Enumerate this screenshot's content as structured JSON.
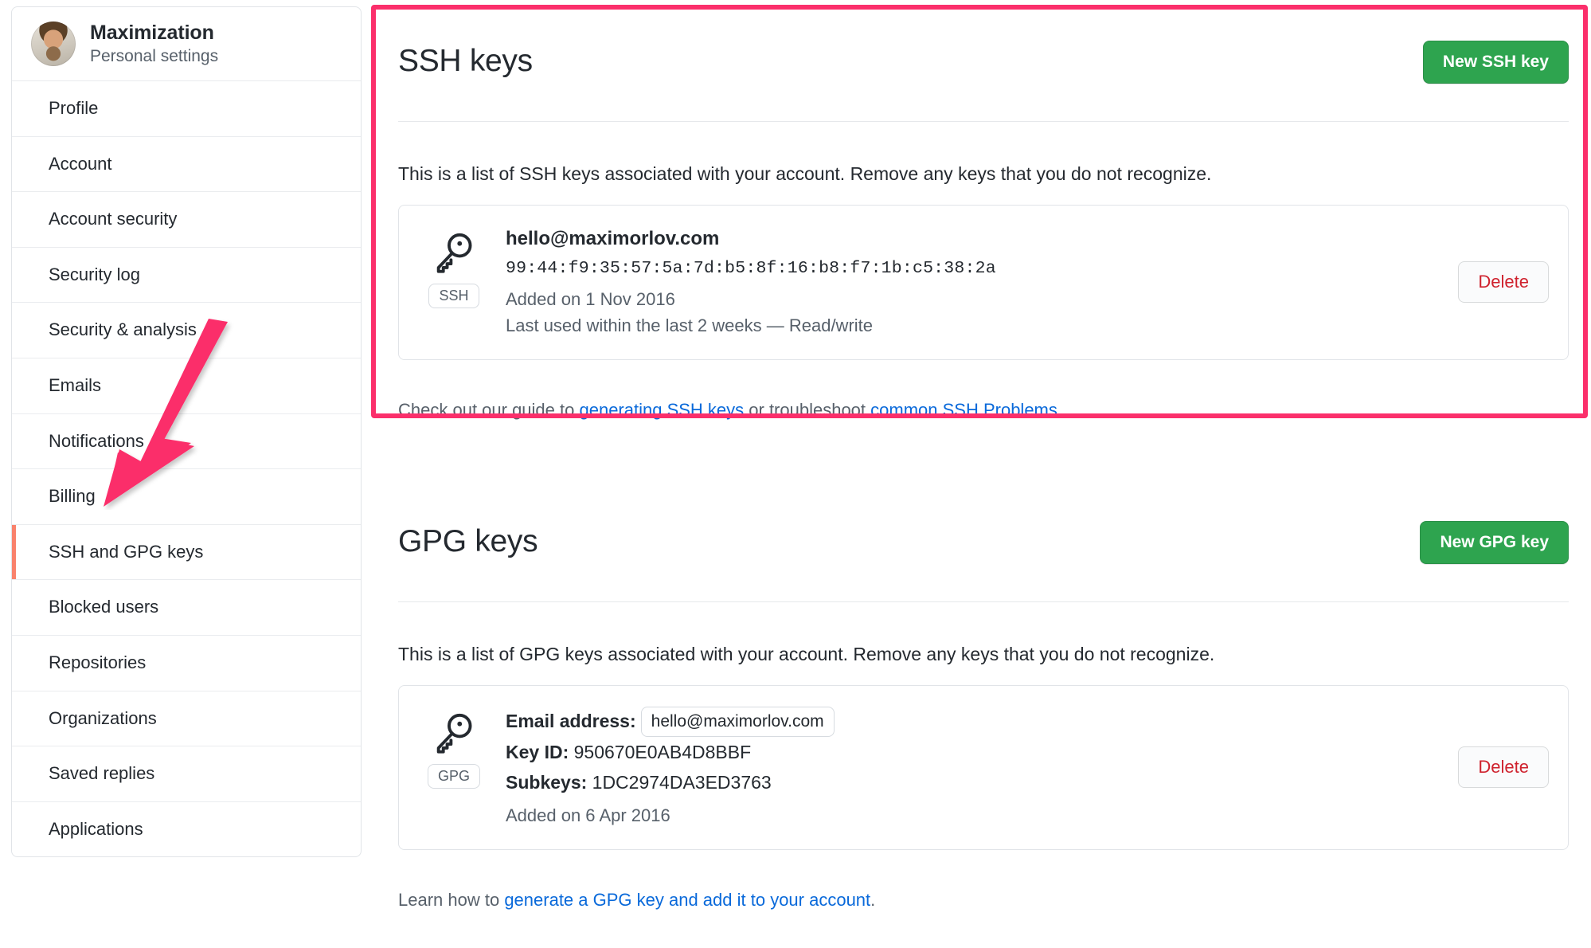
{
  "sidebar": {
    "user": {
      "name": "Maximization",
      "subtitle": "Personal settings",
      "avatar_icon": "user-avatar"
    },
    "items": [
      {
        "label": "Profile",
        "active": false
      },
      {
        "label": "Account",
        "active": false
      },
      {
        "label": "Account security",
        "active": false
      },
      {
        "label": "Security log",
        "active": false
      },
      {
        "label": "Security & analysis",
        "active": false
      },
      {
        "label": "Emails",
        "active": false
      },
      {
        "label": "Notifications",
        "active": false
      },
      {
        "label": "Billing",
        "active": false
      },
      {
        "label": "SSH and GPG keys",
        "active": true
      },
      {
        "label": "Blocked users",
        "active": false
      },
      {
        "label": "Repositories",
        "active": false
      },
      {
        "label": "Organizations",
        "active": false
      },
      {
        "label": "Saved replies",
        "active": false
      },
      {
        "label": "Applications",
        "active": false
      }
    ],
    "active_indicator_color": "#f9826c"
  },
  "annotations": {
    "highlight_box_color": "#fb2f6b",
    "arrow_color": "#fb2f6b",
    "arrow_points_to": "SSH and GPG keys"
  },
  "ssh_section": {
    "title": "SSH keys",
    "new_button": "New SSH key",
    "new_button_color": "#2ea44f",
    "description": "This is a list of SSH keys associated with your account. Remove any keys that you do not recognize.",
    "keys": [
      {
        "badge": "SSH",
        "icon": "key-icon",
        "email": "hello@maximorlov.com",
        "fingerprint": "99:44:f9:35:57:5a:7d:b5:8f:16:b8:f7:1b:c5:38:2a",
        "added": "Added on 1 Nov 2016",
        "last_used": "Last used within the last 2 weeks — Read/write",
        "delete_label": "Delete",
        "delete_color": "#cf222e"
      }
    ],
    "footer": {
      "prefix": "Check out our guide to ",
      "link1": "generating SSH keys",
      "middle": " or troubleshoot ",
      "link2": "common SSH Problems",
      "suffix": ".",
      "link_color": "#0969da"
    }
  },
  "gpg_section": {
    "title": "GPG keys",
    "new_button": "New GPG key",
    "new_button_color": "#2ea44f",
    "description": "This is a list of GPG keys associated with your account. Remove any keys that you do not recognize.",
    "keys": [
      {
        "badge": "GPG",
        "icon": "key-icon",
        "email_label": "Email address:",
        "email": "hello@maximorlov.com",
        "keyid_label": "Key ID:",
        "keyid": "950670E0AB4D8BBF",
        "subkeys_label": "Subkeys:",
        "subkeys": "1DC2974DA3ED3763",
        "added": "Added on 6 Apr 2016",
        "delete_label": "Delete",
        "delete_color": "#cf222e"
      }
    ],
    "footer": {
      "prefix": "Learn how to ",
      "link1": "generate a GPG key and add it to your account",
      "suffix": ".",
      "link_color": "#0969da"
    }
  }
}
